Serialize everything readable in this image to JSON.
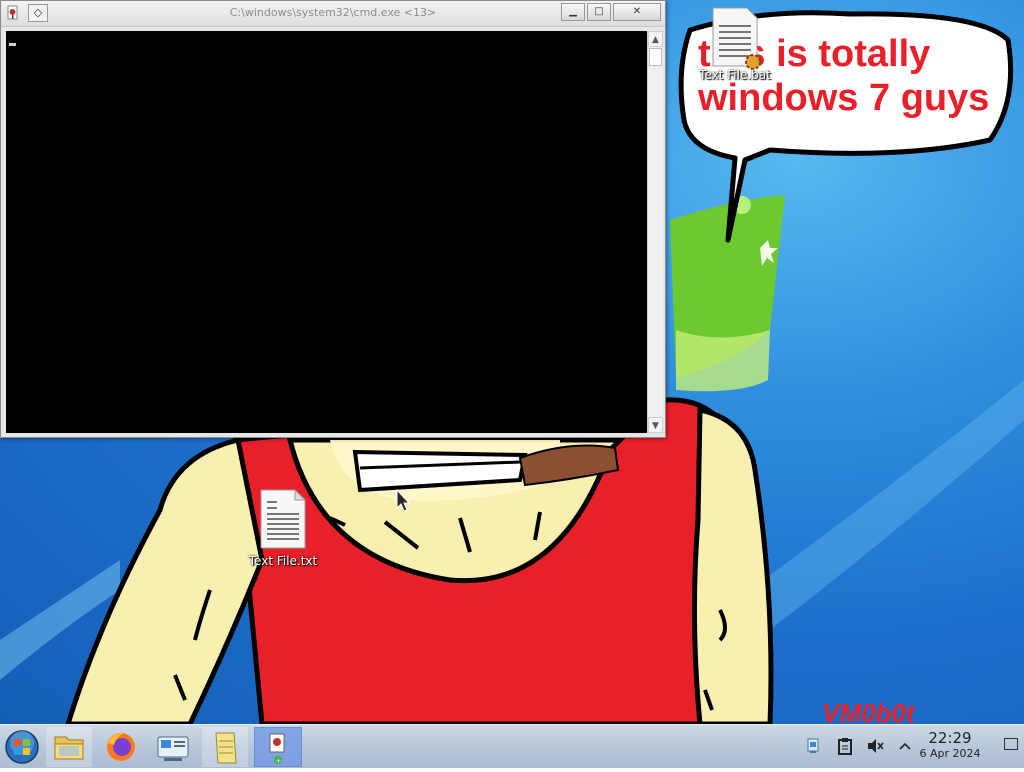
{
  "cmd_window": {
    "title": "C:\\windows\\system32\\cmd.exe <13>",
    "menu_button_glyph": "◇",
    "minimize_glyph": "▁",
    "maximize_glyph": "□",
    "close_glyph": "✕"
  },
  "wallpaper": {
    "speech_line1": "this is totally",
    "speech_line2": "windows 7 guys",
    "signature": "VM0b0t"
  },
  "desktop_icons": [
    {
      "label": "Text File.txt",
      "icon": "text-document-icon"
    },
    {
      "label": "Text File.bat",
      "icon": "batch-file-icon"
    }
  ],
  "taskbar": {
    "items": [
      {
        "name": "start-button",
        "icon": "windows-orb-icon"
      },
      {
        "name": "explorer",
        "icon": "folder-icon"
      },
      {
        "name": "firefox",
        "icon": "firefox-icon"
      },
      {
        "name": "control-panel",
        "icon": "control-panel-icon"
      },
      {
        "name": "notepad",
        "icon": "notepad-icon"
      },
      {
        "name": "cmd",
        "icon": "cmd-icon"
      }
    ],
    "tray": {
      "icons": [
        "network-icon",
        "clipboard-icon",
        "volume-muted-icon",
        "chevron-up-icon"
      ],
      "time": "22:29",
      "date": "6 Apr 2024"
    }
  },
  "colors": {
    "desktop_blue": "#1c6fcb",
    "shirt_red": "#e8202a",
    "skin_yellow": "#f9efb0",
    "speech_text_red": "#e8202a",
    "active_task": "#6e96e6"
  }
}
